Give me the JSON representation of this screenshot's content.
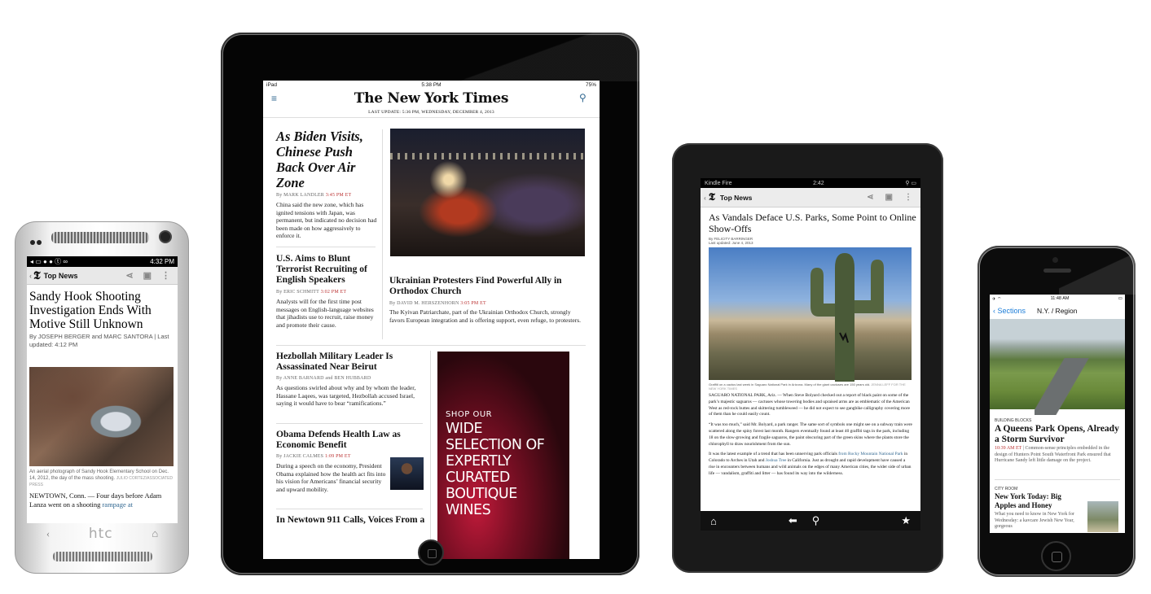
{
  "htc": {
    "status_time": "4:32 PM",
    "section": "Top News",
    "headline": "Sandy Hook Shooting Investigation Ends With Motive Still Unknown",
    "byline": "By JOSEPH BERGER and MARC SANTORA  |  Last updated: 4:12 PM",
    "caption": "An aerial photograph of Sandy Hook Elementary School on Dec. 14, 2012, the day of the mass shooting.",
    "caption_credit": "JULIO CORTEZ/ASSOCIATED PRESS",
    "body": "NEWTOWN, Conn. — Four days before Adam Lanza went on a shooting",
    "body_link": "rampage at",
    "brand": "htc"
  },
  "ipad": {
    "status_left": "iPad",
    "status_time": "5:38 PM",
    "status_battery": "75%",
    "masthead": "The New York Times",
    "last_update": "LAST UPDATE: 5:36 PM, WEDNESDAY, DECEMBER 4, 2013",
    "lead": {
      "headline": "As Biden Visits, Chinese Push Back Over Air Zone",
      "author": "By MARK LANDLER",
      "time": "3:45 PM ET",
      "summary": "China said the new zone, which has ignited tensions with Japan, was permanent, but indicated no decision had been made on how aggressively to enforce it."
    },
    "story2": {
      "headline": "U.S. Aims to Blunt Terrorist Recruiting of English Speakers",
      "author": "By ERIC SCHMITT",
      "time": "3:02 PM ET",
      "summary": "Analysts will for the first time post messages on English-language websites that jihadists use to recruit, raise money and promote their cause."
    },
    "story3": {
      "headline": "Ukrainian Protesters Find Powerful Ally in Orthodox Church",
      "author": "By DAVID M. HERSZENHORN",
      "time": "3:05 PM ET",
      "summary": "The Kyivan Patriarchate, part of the Ukrainian Orthodox Church, strongly favors European integration and is offering support, even refuge, to protesters."
    },
    "story4": {
      "headline": "Hezbollah Military Leader Is Assassinated Near Beirut",
      "author": "By ANNE BARNARD and BEN HUBBARD",
      "summary": "As questions swirled about why and by whom the leader, Hassane Laqees, was targeted, Hezbollah accused Israel, saying it would have to bear “ramifications.”"
    },
    "story5": {
      "headline": "Obama Defends Health Law as Economic Benefit",
      "author": "By JACKIE CALMES",
      "time": "1:09 PM ET",
      "summary": "During a speech on the economy, President Obama explained how the health act fits into his vision for Americans’ financial security and upward mobility."
    },
    "story6": {
      "headline": "In Newtown 911 Calls, Voices From a"
    },
    "ad": {
      "line1": "SHOP OUR",
      "line2": "WIDE SELECTION OF EXPERTLY CURATED BOUTIQUE WINES"
    }
  },
  "kindle": {
    "status_left": "Kindle Fire",
    "status_time": "2:42",
    "section": "Top News",
    "headline": "As Vandals Deface U.S. Parks, Some Point to Online Show-Offs",
    "byline": "By FELICITY BARRINGER",
    "updated": "Last updated: June 4, 2013",
    "caption": "Graffiti on a cactus last week in Saguaro National Park in Arizona. Many of the giant cactuses are 150 years old.",
    "caption_credit": "JENNA LEFF FOR THE NEW YORK TIMES",
    "p1": "SAGUARO NATIONAL PARK, Ariz. — When Steve Bolyard checked out a report of black paint on some of the park’s majestic saguaros — cactuses whose towering bodies and upraised arms are as emblematic of the American West as red-rock buttes and skittering tumbleweed — he did not expect to see gangbike calligraphy covering more of them than he could easily count.",
    "p2": "“It was too much,” said Mr. Bolyard, a park ranger. The same sort of symbols one might see on a subway train were scattered along the spiny forest last month. Rangers eventually found at least 40 graffiti tags in the park, including 18 on the slow-growing and fragile saguaros, the paint obscuring part of the green skins where the plants store the chlorophyll to draw nourishment from the sun.",
    "p3_a": "It was the latest example of a trend that has been unnerving park officials",
    "p3_link1": "from Rocky Mountain National Park",
    "p3_b": "in Colorado to Arches in Utah and",
    "p3_link2": "Joshua Tree",
    "p3_c": "in California. Just as drought and rapid development have caused a rise in encounters between humans and wild animals on the edges of many American cities, the wider side of urban life — vandalism, graffiti and litter — has found its way into the wilderness."
  },
  "iphone": {
    "status_time": "11:48 AM",
    "back_label": "Sections",
    "nav_title": "N.Y. / Region",
    "kicker1": "BUILDING BLOCKS",
    "headline1": "A Queens Park Opens, Already a Storm Survivor",
    "time1": "10:39 AM ET",
    "summary1": "Common-sense principles embedded in the design of Hunters Point South Waterfront Park ensured that Hurricane Sandy left little damage on the project.",
    "kicker2": "CITY ROOM",
    "headline2": "New York Today: Big Apples and Honey",
    "summary2": "What you need to know in New York for Wednesday: a kavcare Jewish New Year, gorgeous"
  }
}
